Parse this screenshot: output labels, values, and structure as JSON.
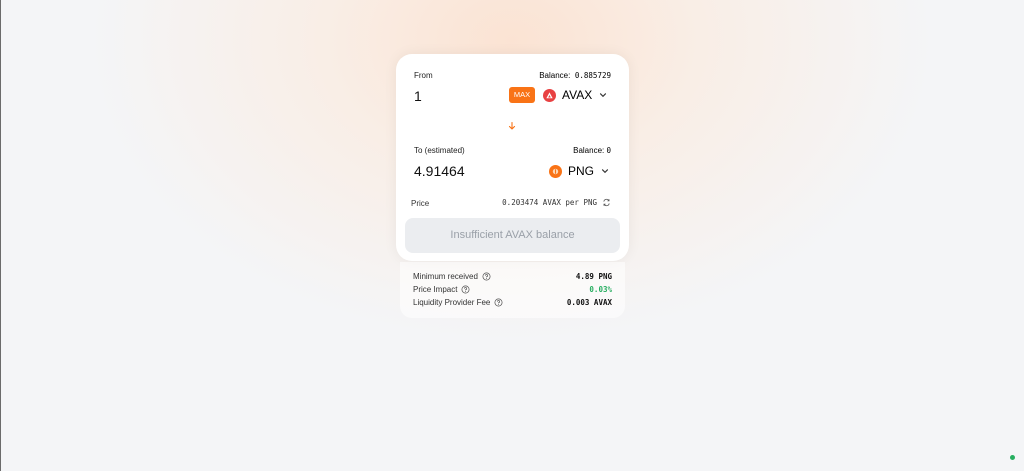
{
  "swap": {
    "from": {
      "label": "From",
      "balance_label": "Balance:",
      "balance_value": "0.885729",
      "amount": "1",
      "max_label": "MAX",
      "token": "AVAX",
      "token_icon": "avax-icon"
    },
    "to": {
      "label": "To (estimated)",
      "balance_label": "Balance:",
      "balance_value": "0",
      "amount": "4.91464",
      "token": "PNG",
      "token_icon": "png-icon"
    },
    "price": {
      "label": "Price",
      "value": "0.203474 AVAX per PNG"
    },
    "action_button": "Insufficient AVAX balance"
  },
  "details": [
    {
      "label": "Minimum received",
      "value": "4.89 PNG"
    },
    {
      "label": "Price Impact",
      "value": "0.03%"
    },
    {
      "label": "Liquidity Provider Fee",
      "value": "0.003 AVAX"
    }
  ],
  "colors": {
    "accent": "#f97316",
    "avax": "#e84142",
    "positive": "#27ae60",
    "disabled_button_bg": "#ebedf0",
    "disabled_button_text": "#9aa0a8"
  }
}
